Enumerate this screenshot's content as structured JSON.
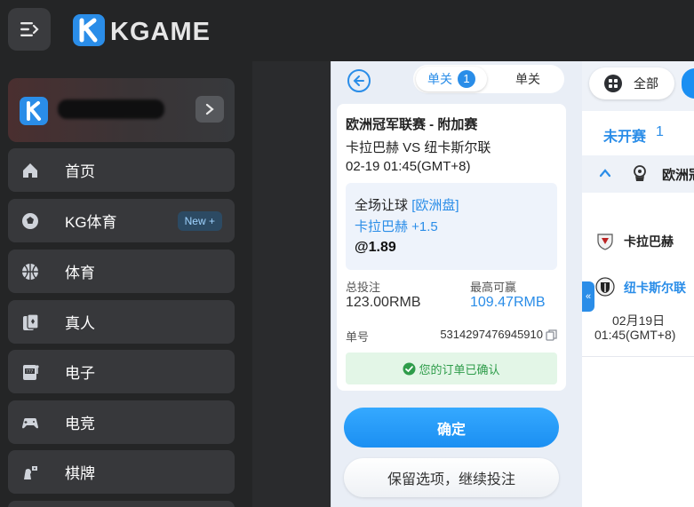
{
  "brand": {
    "logo_text": "KGAME"
  },
  "sidebar": {
    "items": [
      {
        "label": "首页",
        "icon": "home-icon"
      },
      {
        "label": "KG体育",
        "icon": "soccer-ball-icon",
        "badge": "New"
      },
      {
        "label": "体育",
        "icon": "basketball-icon"
      },
      {
        "label": "真人",
        "icon": "cards-icon"
      },
      {
        "label": "电子",
        "icon": "slot-machine-icon"
      },
      {
        "label": "电竞",
        "icon": "gamepad-icon"
      },
      {
        "label": "棋牌",
        "icon": "chess-icon"
      }
    ]
  },
  "betslip": {
    "tabs": {
      "active": "单关",
      "active_count": "1",
      "inactive": "单关"
    },
    "league": "欧洲冠军联赛 - 附加赛",
    "match": "卡拉巴赫 VS 纽卡斯尔联",
    "time": "02-19 01:45(GMT+8)",
    "market": "全场让球",
    "market_tag": "[欧洲盘]",
    "selection": "卡拉巴赫 +1.5",
    "odds": "@1.89",
    "stake_label": "总投注",
    "stake_value": "123.00RMB",
    "win_label": "最高可赢",
    "win_value": "109.47RMB",
    "order_label": "单号",
    "order_value": "5314297476945910",
    "confirmed": "您的订单已确认",
    "ok_button": "确定",
    "keep_button": "保留选项，继续投注"
  },
  "events": {
    "filter_all": "全部",
    "status_title": "未开赛",
    "status_count": "1",
    "league_name": "欧洲冠",
    "home_team": "卡拉巴赫",
    "away_team": "纽卡斯尔联",
    "date": "02月19日",
    "time": "01:45(GMT+8)",
    "side_tab": "«"
  },
  "colors": {
    "accent": "#2a8de8",
    "success": "#2e9c4a",
    "sidebar_bg": "#242526",
    "nav_item_bg": "#37383b"
  }
}
